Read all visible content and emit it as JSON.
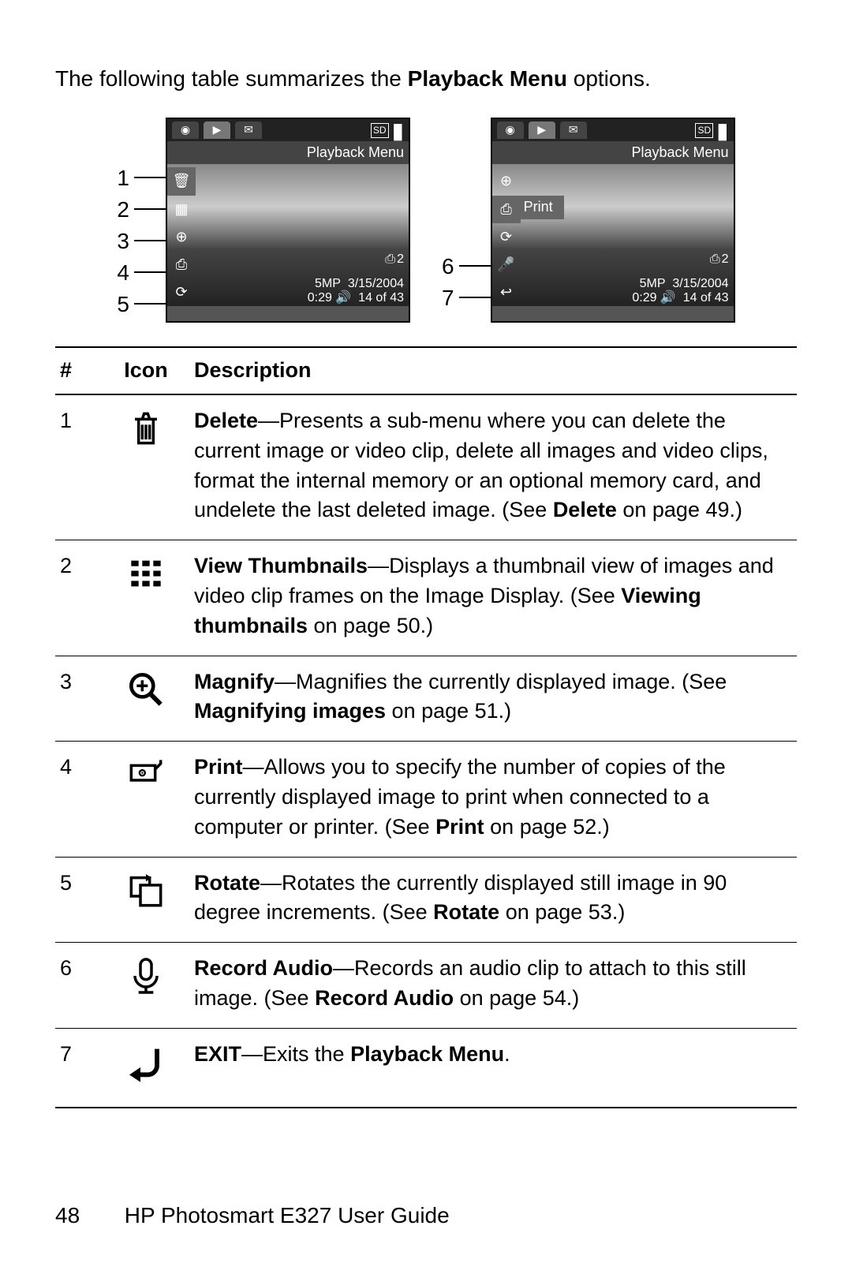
{
  "intro": {
    "pre": "The following table summarizes the ",
    "bold": "Playback Menu",
    "post": " options."
  },
  "screens": {
    "title": "Playback Menu",
    "meta_line1_left": "5MP",
    "meta_line1_right": "3/15/2004",
    "meta_line2_left": "0:29",
    "meta_line2_right": "14 of 43",
    "print_label": "Print",
    "print_count": "2",
    "left_callouts": [
      "1",
      "2",
      "3",
      "4",
      "5"
    ],
    "right_callouts": [
      "6",
      "7"
    ]
  },
  "table": {
    "headers": {
      "num": "#",
      "icon": "Icon",
      "desc": "Description"
    },
    "rows": [
      {
        "num": "1",
        "icon": "trash-icon",
        "title": "Delete",
        "body": "—Presents a sub-menu where you can delete the current image or video clip, delete all images and video clips, format the internal memory or an optional memory card, and undelete the last deleted image. (See ",
        "ref": "Delete",
        "tail": " on page 49.)"
      },
      {
        "num": "2",
        "icon": "thumbnails-icon",
        "title": "View Thumbnails",
        "body": "—Displays a thumbnail view of images and video clip frames on the Image Display. (See ",
        "ref": "Viewing thumbnails",
        "tail": " on page 50.)"
      },
      {
        "num": "3",
        "icon": "magnify-icon",
        "title": "Magnify",
        "body": "—Magnifies the currently displayed image. (See ",
        "ref": "Magnifying images",
        "tail": " on page 51.)"
      },
      {
        "num": "4",
        "icon": "print-icon",
        "title": "Print",
        "body": "—Allows you to specify the number of copies of the currently displayed image to print when connected to a computer or printer. (See ",
        "ref": "Print",
        "tail": " on page 52.)"
      },
      {
        "num": "5",
        "icon": "rotate-icon",
        "title": "Rotate",
        "body": "—Rotates the currently displayed still image in 90 degree increments. (See ",
        "ref": "Rotate",
        "tail": " on page 53.)"
      },
      {
        "num": "6",
        "icon": "mic-icon",
        "title": "Record Audio",
        "body": "—Records an audio clip to attach to this still image. (See ",
        "ref": "Record Audio",
        "tail": " on page 54.)"
      },
      {
        "num": "7",
        "icon": "exit-icon",
        "title": "EXIT",
        "body": "—Exits the ",
        "ref": "Playback Menu",
        "tail": "."
      }
    ]
  },
  "footer": {
    "page": "48",
    "title": "HP Photosmart E327 User Guide"
  }
}
